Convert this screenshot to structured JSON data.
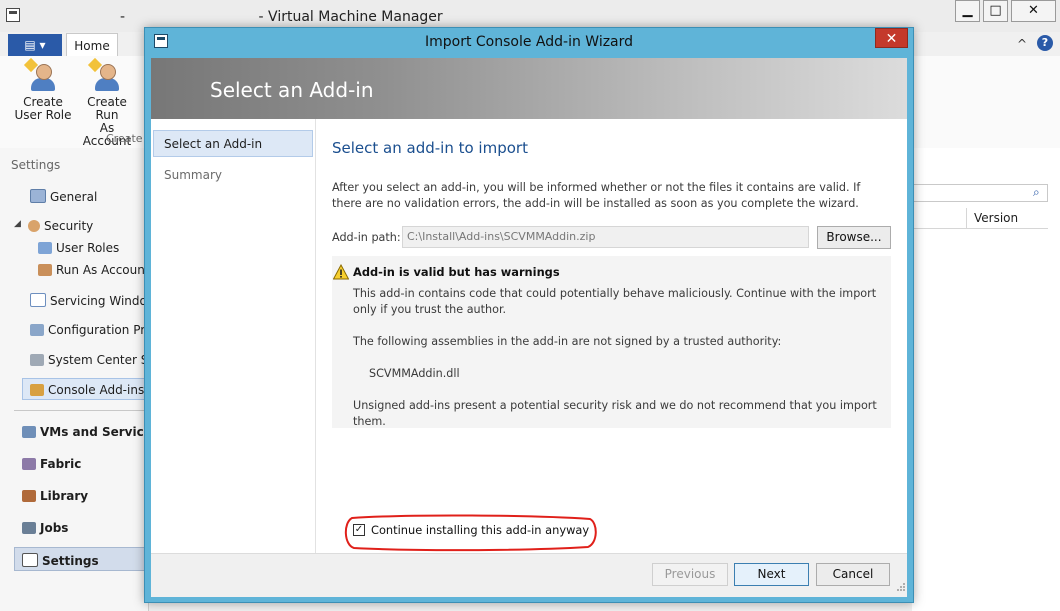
{
  "main_window": {
    "title": "-                              - Virtual Machine Manager",
    "controls": {
      "minimize": "▁",
      "maximize": "□",
      "close": "✕"
    }
  },
  "ribbon": {
    "file_tab": "▤ ▾",
    "home_tab": "Home",
    "buttons": [
      {
        "label_line1": "Create",
        "label_line2": "User Role"
      },
      {
        "label_line1": "Create Run",
        "label_line2": "As Account"
      }
    ],
    "group_label": "Create",
    "collapse": "^",
    "help": "?"
  },
  "nav": {
    "heading": "Settings",
    "items": [
      {
        "label": "General",
        "icon": "general-icon"
      },
      {
        "label": "Security",
        "icon": "security-icon",
        "expander": "◢"
      },
      {
        "label": "User Roles",
        "icon": "user-roles-icon"
      },
      {
        "label": "Run As Accounts",
        "icon": "run-as-icon"
      },
      {
        "label": "Servicing Windows",
        "icon": "calendar-icon"
      },
      {
        "label": "Configuration Providers",
        "icon": "config-icon"
      },
      {
        "label": "System Center Settings",
        "icon": "system-center-icon"
      },
      {
        "label": "Console Add-ins",
        "icon": "addins-icon"
      }
    ],
    "workspaces": [
      {
        "label": "VMs and Services",
        "icon": "vms-icon"
      },
      {
        "label": "Fabric",
        "icon": "fabric-icon"
      },
      {
        "label": "Library",
        "icon": "library-icon"
      },
      {
        "label": "Jobs",
        "icon": "jobs-icon"
      },
      {
        "label": "Settings",
        "icon": "settings-icon"
      }
    ]
  },
  "right_pane": {
    "column_header": "Version",
    "search_icon": "⌕"
  },
  "dialog": {
    "title": "Import Console Add-in Wizard",
    "close": "✕",
    "banner": "Select an Add-in",
    "steps": [
      "Select an Add-in",
      "Summary"
    ],
    "heading": "Select an add-in to import",
    "description": "After you select an add-in, you will be informed whether or not the files it contains are valid. If there are no validation errors, the add-in will be installed as soon as you complete the wizard.",
    "path_label": "Add-in path:",
    "path_value": "C:\\Install\\Add-ins\\SCVMMAddin.zip",
    "browse": "Browse...",
    "warning": {
      "title": "Add-in is valid but has warnings",
      "text1": "This add-in contains code that could potentially behave maliciously. Continue with the import only if you trust the author.",
      "text2": "The following assemblies in the add-in are not signed by a trusted authority:",
      "assembly": "SCVMMAddin.dll",
      "text3": "Unsigned add-ins present a potential security risk and we do not recommend that you import them."
    },
    "checkbox": {
      "label": "Continue installing this add-in anyway",
      "checked": true,
      "mark": "✓"
    },
    "buttons": {
      "previous": "Previous",
      "next": "Next",
      "cancel": "Cancel"
    }
  },
  "colors": {
    "dialog_frame": "#5fb4d8",
    "heading_blue": "#1b4f8f",
    "highlight_ring": "#e0201a",
    "selection": "#dde8f6"
  }
}
